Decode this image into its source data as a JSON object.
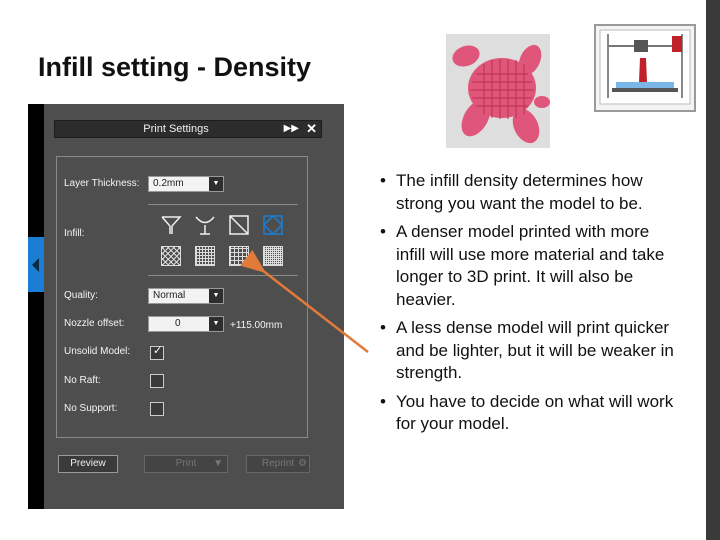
{
  "slide": {
    "title": "Infill setting - Density",
    "bullets": [
      "The infill density determines how strong you want the model to be.",
      "A denser model printed with more infill will use more material and take longer to 3D print. It will also be heavier.",
      "A less dense model will print quicker and be lighter, but it will be weaker in strength.",
      "You have to decide on what will work for your model."
    ],
    "arrow_color": "#e07b39"
  },
  "panel": {
    "title": "Print Settings",
    "layer_thickness_label": "Layer Thickness:",
    "layer_thickness_value": "0.2mm",
    "infill_label": "Infill:",
    "quality_label": "Quality:",
    "quality_value": "Normal",
    "nozzle_offset_label": "Nozzle offset:",
    "nozzle_offset_value": "0",
    "nozzle_offset_readout": "+115.00mm",
    "unsolid_model_label": "Unsolid Model:",
    "unsolid_model_checked": true,
    "no_raft_label": "No Raft:",
    "no_raft_checked": false,
    "no_support_label": "No Support:",
    "no_support_checked": false,
    "preview_label": "Preview",
    "print_label": "Print",
    "reprint_label": "Reprint",
    "selected_infill_shape": 3,
    "accent_color": "#1a7fd4"
  },
  "icons": {
    "expand": "double-arrow-icon",
    "close": "close-icon",
    "side_tab": "chevron-left-icon",
    "settings": "gear-icon"
  }
}
